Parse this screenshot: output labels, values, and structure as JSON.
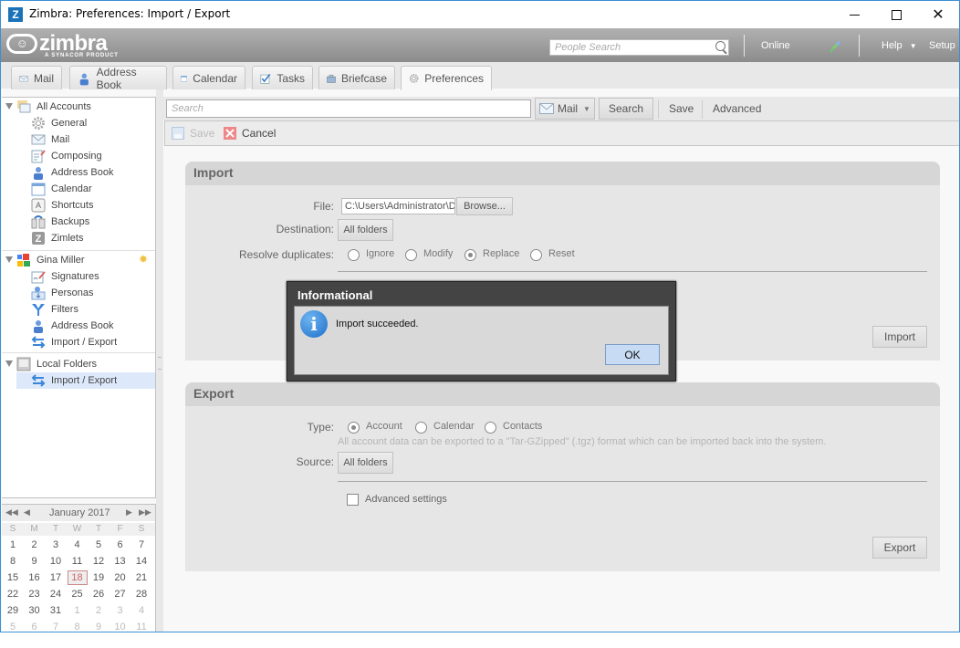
{
  "window": {
    "title": "Zimbra: Preferences: Import / Export",
    "app_icon": "Z",
    "controls": [
      "minimize",
      "maximize",
      "close"
    ]
  },
  "header": {
    "logo": "zimbra",
    "logo_sub": "A SYNACOR PRODUCT",
    "people_search_placeholder": "People Search",
    "status": "Online",
    "help": "Help",
    "setup": "Setup",
    "plug_icon": "connection-plug-icon"
  },
  "tabs": [
    {
      "label": "Mail",
      "icon": "mail-icon"
    },
    {
      "label": "Address Book",
      "icon": "contact-icon"
    },
    {
      "label": "Calendar",
      "icon": "calendar-icon"
    },
    {
      "label": "Tasks",
      "icon": "task-check-icon"
    },
    {
      "label": "Briefcase",
      "icon": "briefcase-icon"
    },
    {
      "label": "Preferences",
      "icon": "gear-icon",
      "active": true
    }
  ],
  "sidebar": {
    "groups": [
      {
        "label": "All Accounts",
        "items": [
          "General",
          "Mail",
          "Composing",
          "Address Book",
          "Calendar",
          "Shortcuts",
          "Backups",
          "Zimlets"
        ]
      },
      {
        "label": "Gina Miller",
        "items": [
          "Signatures",
          "Personas",
          "Filters",
          "Address Book",
          "Import / Export"
        ]
      },
      {
        "label": "Local Folders",
        "items": [
          "Import / Export"
        ],
        "selected": "Import / Export"
      }
    ]
  },
  "minical": {
    "month": "January 2017",
    "dow": [
      "S",
      "M",
      "T",
      "W",
      "T",
      "F",
      "S"
    ],
    "weeks": [
      [
        "1",
        "2",
        "3",
        "4",
        "5",
        "6",
        "7"
      ],
      [
        "8",
        "9",
        "10",
        "11",
        "12",
        "13",
        "14"
      ],
      [
        "15",
        "16",
        "17",
        "18",
        "19",
        "20",
        "21"
      ],
      [
        "22",
        "23",
        "24",
        "25",
        "26",
        "27",
        "28"
      ],
      [
        "29",
        "30",
        "31",
        "1",
        "2",
        "3",
        "4"
      ],
      [
        "5",
        "6",
        "7",
        "8",
        "9",
        "10",
        "11"
      ]
    ],
    "today": "18"
  },
  "toolbar": {
    "search_placeholder": "Search",
    "search_type": "Mail",
    "search_button": "Search",
    "save": "Save",
    "advanced": "Advanced"
  },
  "actions": {
    "save": "Save",
    "cancel": "Cancel"
  },
  "import": {
    "title": "Import",
    "file_label": "File:",
    "file_value": "C:\\Users\\Administrator\\D",
    "browse": "Browse...",
    "destination_label": "Destination:",
    "destination_value": "All folders",
    "resolve_label": "Resolve duplicates:",
    "resolve_options": [
      "Ignore",
      "Modify",
      "Replace",
      "Reset"
    ],
    "resolve_selected": "Replace",
    "button": "Import"
  },
  "export": {
    "title": "Export",
    "type_label": "Type:",
    "type_options": [
      "Account",
      "Calendar",
      "Contacts"
    ],
    "type_selected": "Account",
    "hint": "All account data can be exported to a \"Tar-GZipped\" (.tgz) format which can be imported back into the system.",
    "source_label": "Source:",
    "source_value": "All folders",
    "advanced_settings": "Advanced settings",
    "advanced_checked": false,
    "button": "Export"
  },
  "dialog": {
    "title": "Informational",
    "message": "Import succeeded.",
    "ok": "OK"
  }
}
